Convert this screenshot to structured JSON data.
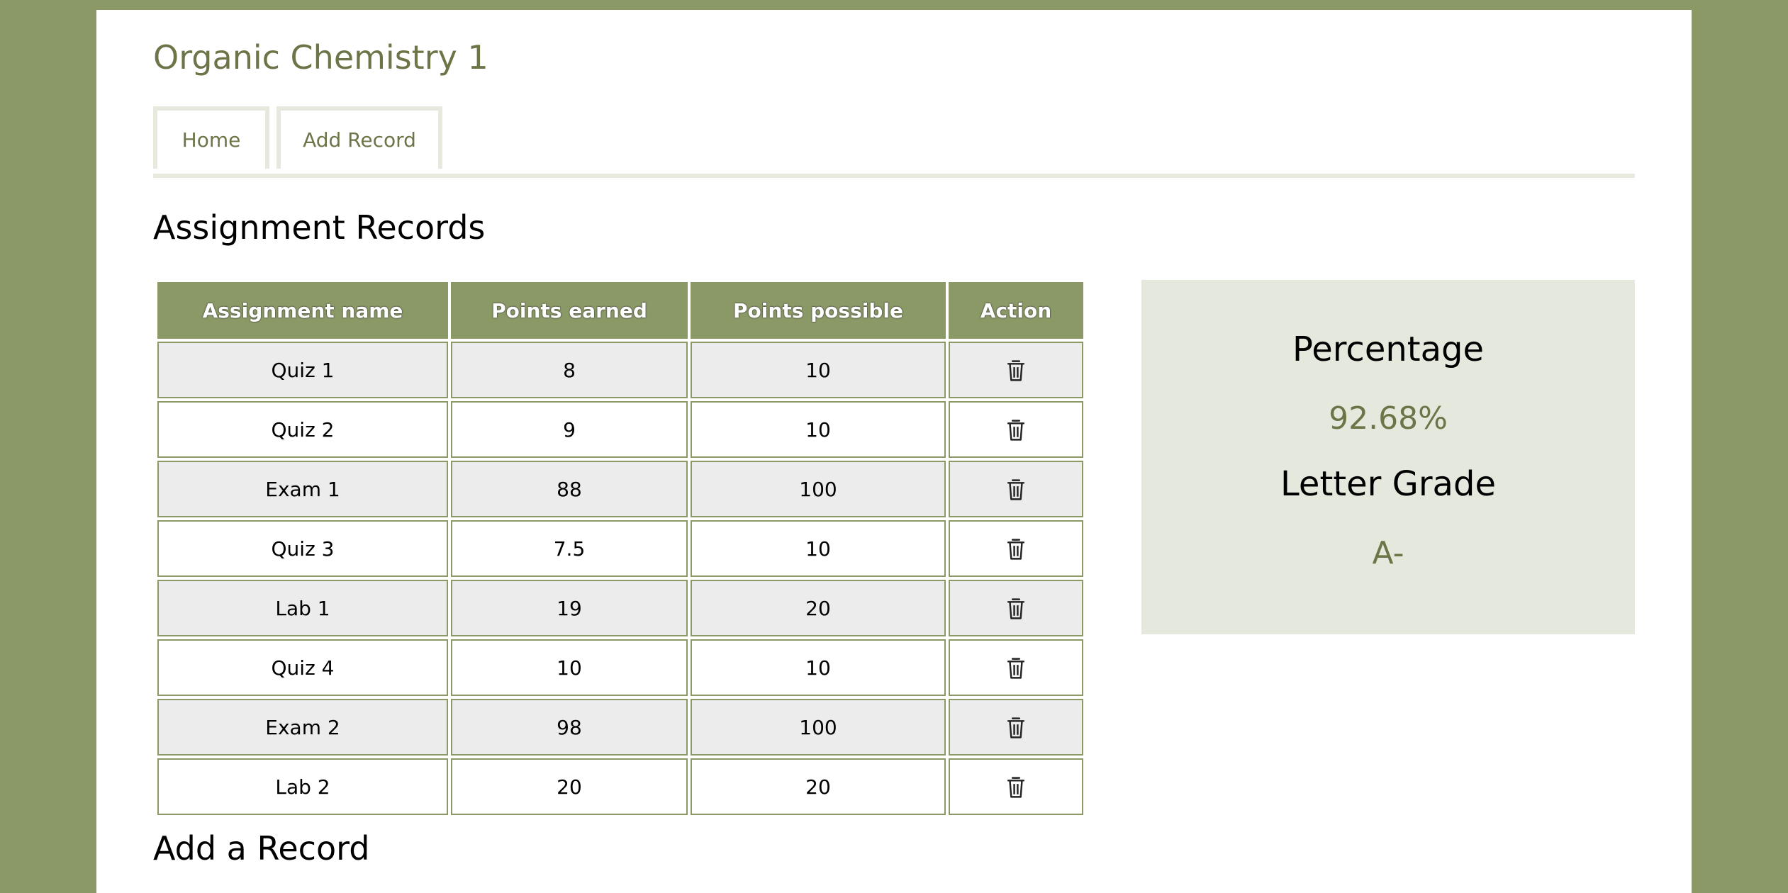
{
  "site": {
    "title": "Organic Chemistry 1"
  },
  "nav": {
    "home_label": "Home",
    "add_record_label": "Add Record"
  },
  "records_section": {
    "title": "Assignment Records",
    "columns": [
      "Assignment name",
      "Points earned",
      "Points possible",
      "Action"
    ],
    "rows": [
      {
        "name": "Quiz 1",
        "earned": "8",
        "possible": "10"
      },
      {
        "name": "Quiz 2",
        "earned": "9",
        "possible": "10"
      },
      {
        "name": "Exam 1",
        "earned": "88",
        "possible": "100"
      },
      {
        "name": "Quiz 3",
        "earned": "7.5",
        "possible": "10"
      },
      {
        "name": "Lab 1",
        "earned": "19",
        "possible": "20"
      },
      {
        "name": "Quiz 4",
        "earned": "10",
        "possible": "10"
      },
      {
        "name": "Exam 2",
        "earned": "98",
        "possible": "100"
      },
      {
        "name": "Lab 2",
        "earned": "20",
        "possible": "20"
      }
    ],
    "action_icon": "trash-icon"
  },
  "grade": {
    "percentage_label": "Percentage",
    "percentage_value": "92.68%",
    "letter_label": "Letter Grade",
    "letter_value": "A-"
  },
  "add_section": {
    "title": "Add a Record"
  },
  "colors": {
    "background": "#8a9966",
    "accent_text": "#6b7548",
    "panel_background": "#e5e8dd",
    "table_header": "#8a9966",
    "row_alt": "#ececec"
  }
}
